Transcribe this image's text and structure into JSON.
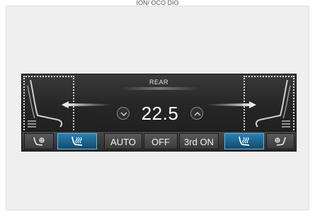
{
  "caption": "ION/ OCO DIO",
  "panel": {
    "zone_label": "REAR",
    "temperature": "22.5",
    "buttons": {
      "auto": "AUTO",
      "off": "OFF",
      "third_row": "3rd ON"
    },
    "seat_heater_left_active": true,
    "seat_heater_right_active": true
  },
  "colors": {
    "active_accent": "#2a7fb2",
    "panel_bg": "#262626"
  },
  "icons": {
    "left_seat": "seat-outline-icon",
    "right_seat": "seat-outline-icon",
    "left_arrow": "airflow-arrow-left-icon",
    "right_arrow": "airflow-arrow-right-icon",
    "temp_down": "chevron-down-icon",
    "temp_up": "chevron-up-icon",
    "fan_left": "seat-fan-icon",
    "fan_right": "seat-fan-icon",
    "heat_left": "seat-heater-icon",
    "heat_right": "seat-heater-icon"
  }
}
